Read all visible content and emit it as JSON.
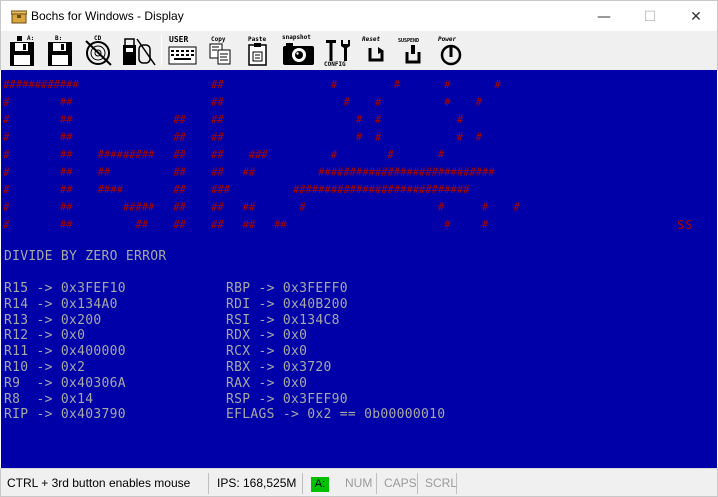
{
  "window": {
    "title": "Bochs for Windows - Display",
    "controls": {
      "minimize": "—",
      "maximize": "☐",
      "close": "✕"
    }
  },
  "toolbar": {
    "items": [
      {
        "id": "floppy-a",
        "label": "A:"
      },
      {
        "id": "floppy-b",
        "label": "B:"
      },
      {
        "id": "cdrom",
        "label": "CD"
      },
      {
        "id": "usb",
        "label": ""
      },
      {
        "id": "mouse",
        "label": ""
      },
      {
        "id": "user",
        "label": "USER"
      },
      {
        "id": "copy",
        "label": "Copy"
      },
      {
        "id": "paste",
        "label": "Paste"
      },
      {
        "id": "snapshot",
        "label": "snapshot"
      },
      {
        "id": "config",
        "label": "CONFIG"
      },
      {
        "id": "reset",
        "label": "Reset"
      },
      {
        "id": "suspend",
        "label": "SUSPEND"
      },
      {
        "id": "power",
        "label": "Power"
      }
    ]
  },
  "screen": {
    "banner_color": "#a80000",
    "text_color": "#a8a8a8",
    "background": "#0000a8",
    "corner_mark": "SS",
    "error_title": "DIVIDE BY ZERO ERROR",
    "registers_left": [
      "R15 -> 0x3FEF10",
      "R14 -> 0x134A0",
      "R13 -> 0x200",
      "R12 -> 0x0",
      "R11 -> 0x400000",
      "R10 -> 0x2",
      "R9  -> 0x40306A",
      "R8  -> 0x14",
      "RIP -> 0x403790"
    ],
    "registers_right": [
      "RBP -> 0x3FEFF0",
      "RDI -> 0x40B200",
      "RSI -> 0x134C8",
      "RDX -> 0x0",
      "RCX -> 0x0",
      "RBX -> 0x3720",
      "RAX -> 0x0",
      "RSP -> 0x3FEF90",
      "EFLAGS -> 0x2 == 0b00000010"
    ]
  },
  "statusbar": {
    "hint": "CTRL + 3rd button enables mouse",
    "ips": "IPS: 168,525M",
    "drive_indicator": "A:",
    "num": "NUM",
    "caps": "CAPS",
    "scrl": "SCRL"
  }
}
